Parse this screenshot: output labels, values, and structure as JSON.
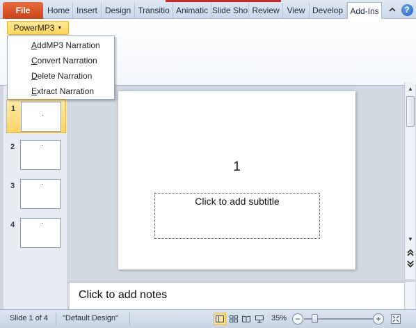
{
  "ribbon": {
    "file_tab": "File",
    "tabs": [
      "Home",
      "Insert",
      "Design",
      "Transitio",
      "Animatic",
      "Slide Sho",
      "Review",
      "View",
      "Develop",
      "Add-Ins"
    ],
    "active_tab": "Add-Ins",
    "minimize_icon": "chevron-up-icon",
    "help_icon": "?"
  },
  "addins": {
    "powermp3_label": "PowerMP3",
    "menu": [
      {
        "underline": "A",
        "rest": "ddMP3 Narration"
      },
      {
        "underline": "C",
        "rest": "onvert Narration"
      },
      {
        "underline": "D",
        "rest": "elete Narration"
      },
      {
        "underline": "E",
        "rest": "xtract Narration"
      }
    ]
  },
  "slides_panel": {
    "slides": [
      {
        "num": "1",
        "selected": true
      },
      {
        "num": "2",
        "selected": false
      },
      {
        "num": "3",
        "selected": false
      },
      {
        "num": "4",
        "selected": false
      }
    ]
  },
  "slide": {
    "title": "1",
    "subtitle_placeholder": "Click to add subtitle"
  },
  "notes": {
    "placeholder": "Click to add notes"
  },
  "status": {
    "slide_info": "Slide 1 of 4",
    "theme": "\"Default Design\"",
    "zoom": "35%",
    "zoom_level": 0.35
  },
  "colors": {
    "file_tab": "#d4531f",
    "accent_selected": "#fcd468",
    "ribbon_bg": "#dfe8f4"
  }
}
